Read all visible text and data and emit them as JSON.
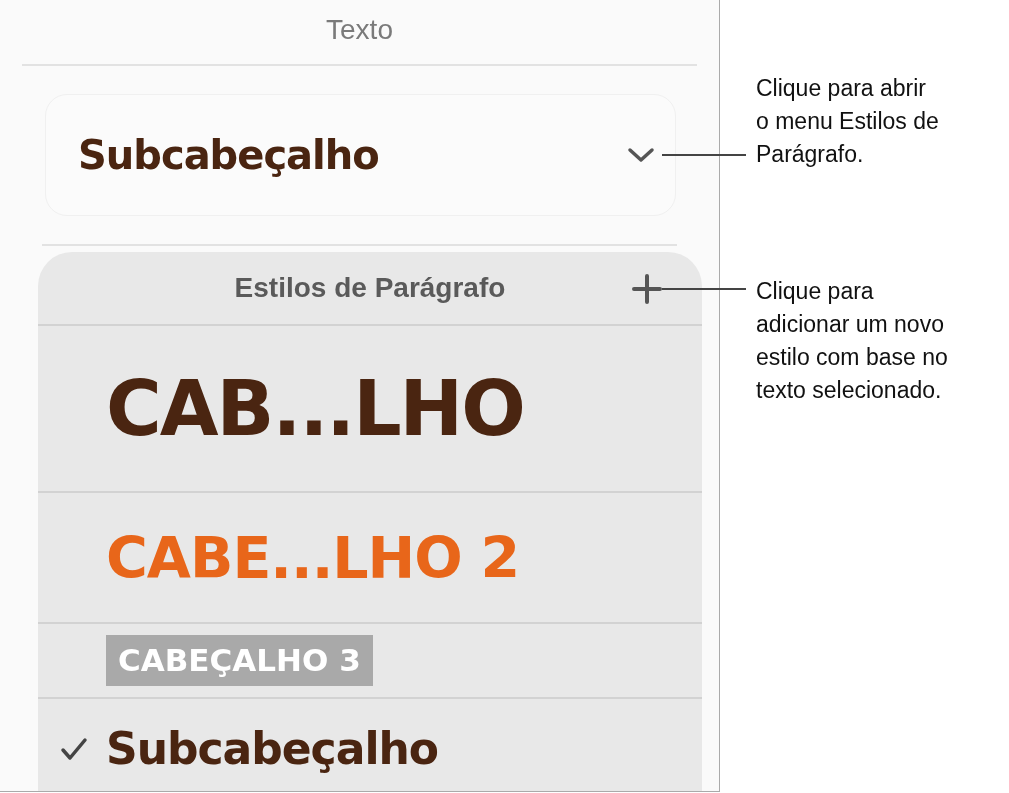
{
  "panel": {
    "title": "Texto",
    "style_button": {
      "label": "Subcabeçalho"
    },
    "popover": {
      "title": "Estilos de Parágrafo",
      "styles": [
        {
          "label": "CAB...LHO",
          "kind": "heading",
          "selected": false
        },
        {
          "label": "CABE...LHO 2",
          "kind": "heading2",
          "selected": false
        },
        {
          "label": "CABEÇALHO 3",
          "kind": "heading3",
          "selected": false
        },
        {
          "label": "Subcabeçalho",
          "kind": "subheading",
          "selected": true
        }
      ]
    }
  },
  "callouts": [
    {
      "lines": [
        "Clique para abrir",
        "o menu Estilos de",
        "Parágrafo."
      ]
    },
    {
      "lines": [
        "Clique para",
        "adicionar um novo",
        "estilo com base no",
        "texto selecionado."
      ]
    }
  ]
}
